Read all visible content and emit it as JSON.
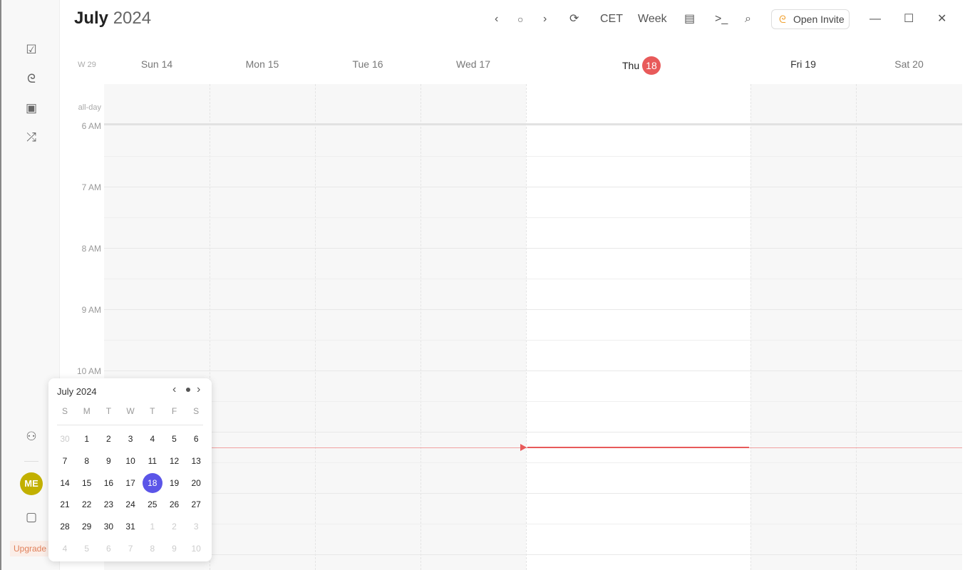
{
  "header": {
    "month": "July",
    "year": "2024",
    "tz": "CET",
    "view": "Week",
    "invite": "Open Invite"
  },
  "week_label": "W 29",
  "days": [
    {
      "label": "Sun 14"
    },
    {
      "label": "Mon 15"
    },
    {
      "label": "Tue 16"
    },
    {
      "label": "Wed 17"
    },
    {
      "label": "Thu",
      "num": "18",
      "today": true
    },
    {
      "label": "Fri 19"
    },
    {
      "label": "Sat 20"
    }
  ],
  "allday": "all-day",
  "hours": [
    "6 AM",
    "7 AM",
    "8 AM",
    "9 AM",
    "10 AM"
  ],
  "sidebar": {
    "avatar": "ME",
    "upgrade": "Upgrade"
  },
  "mini": {
    "title": "July 2024",
    "weekdays": [
      "S",
      "M",
      "T",
      "W",
      "T",
      "F",
      "S"
    ],
    "weeks": [
      [
        "30",
        "1",
        "2",
        "3",
        "4",
        "5",
        "6"
      ],
      [
        "7",
        "8",
        "9",
        "10",
        "11",
        "12",
        "13"
      ],
      [
        "14",
        "15",
        "16",
        "17",
        "18",
        "19",
        "20"
      ],
      [
        "21",
        "22",
        "23",
        "24",
        "25",
        "26",
        "27"
      ],
      [
        "28",
        "29",
        "30",
        "31",
        "1",
        "2",
        "3"
      ],
      [
        "4",
        "5",
        "6",
        "7",
        "8",
        "9",
        "10"
      ]
    ],
    "today": "18"
  },
  "colors": {
    "today": "#e85a5a",
    "accent": "#5b55e8",
    "avatar": "#c2b000",
    "now_line": "#e85a5a"
  }
}
